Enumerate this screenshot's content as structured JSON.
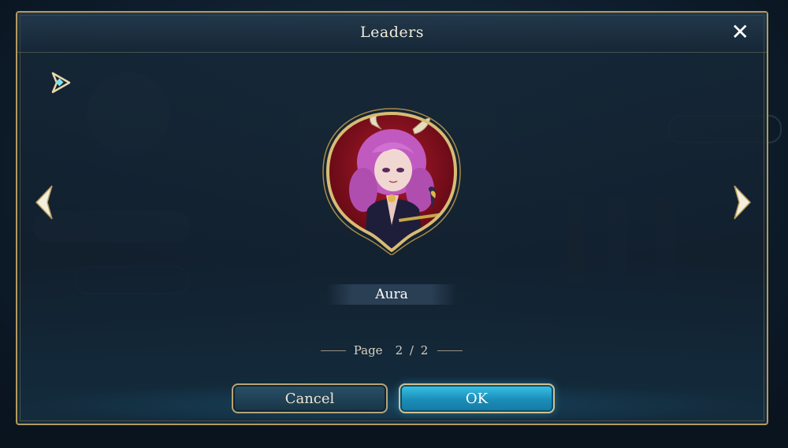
{
  "dialog": {
    "title": "Leaders",
    "close_icon": "close-icon",
    "character_name": "Aura",
    "page_label": "Page",
    "page_current": "2",
    "page_separator": "/",
    "page_total": "2",
    "cancel_label": "Cancel",
    "ok_label": "OK"
  },
  "colors": {
    "gold_border": "#b49a5e",
    "ok_button": "#1b8db8",
    "cancel_button": "#2a5168",
    "portrait_background": "#8a1020"
  }
}
